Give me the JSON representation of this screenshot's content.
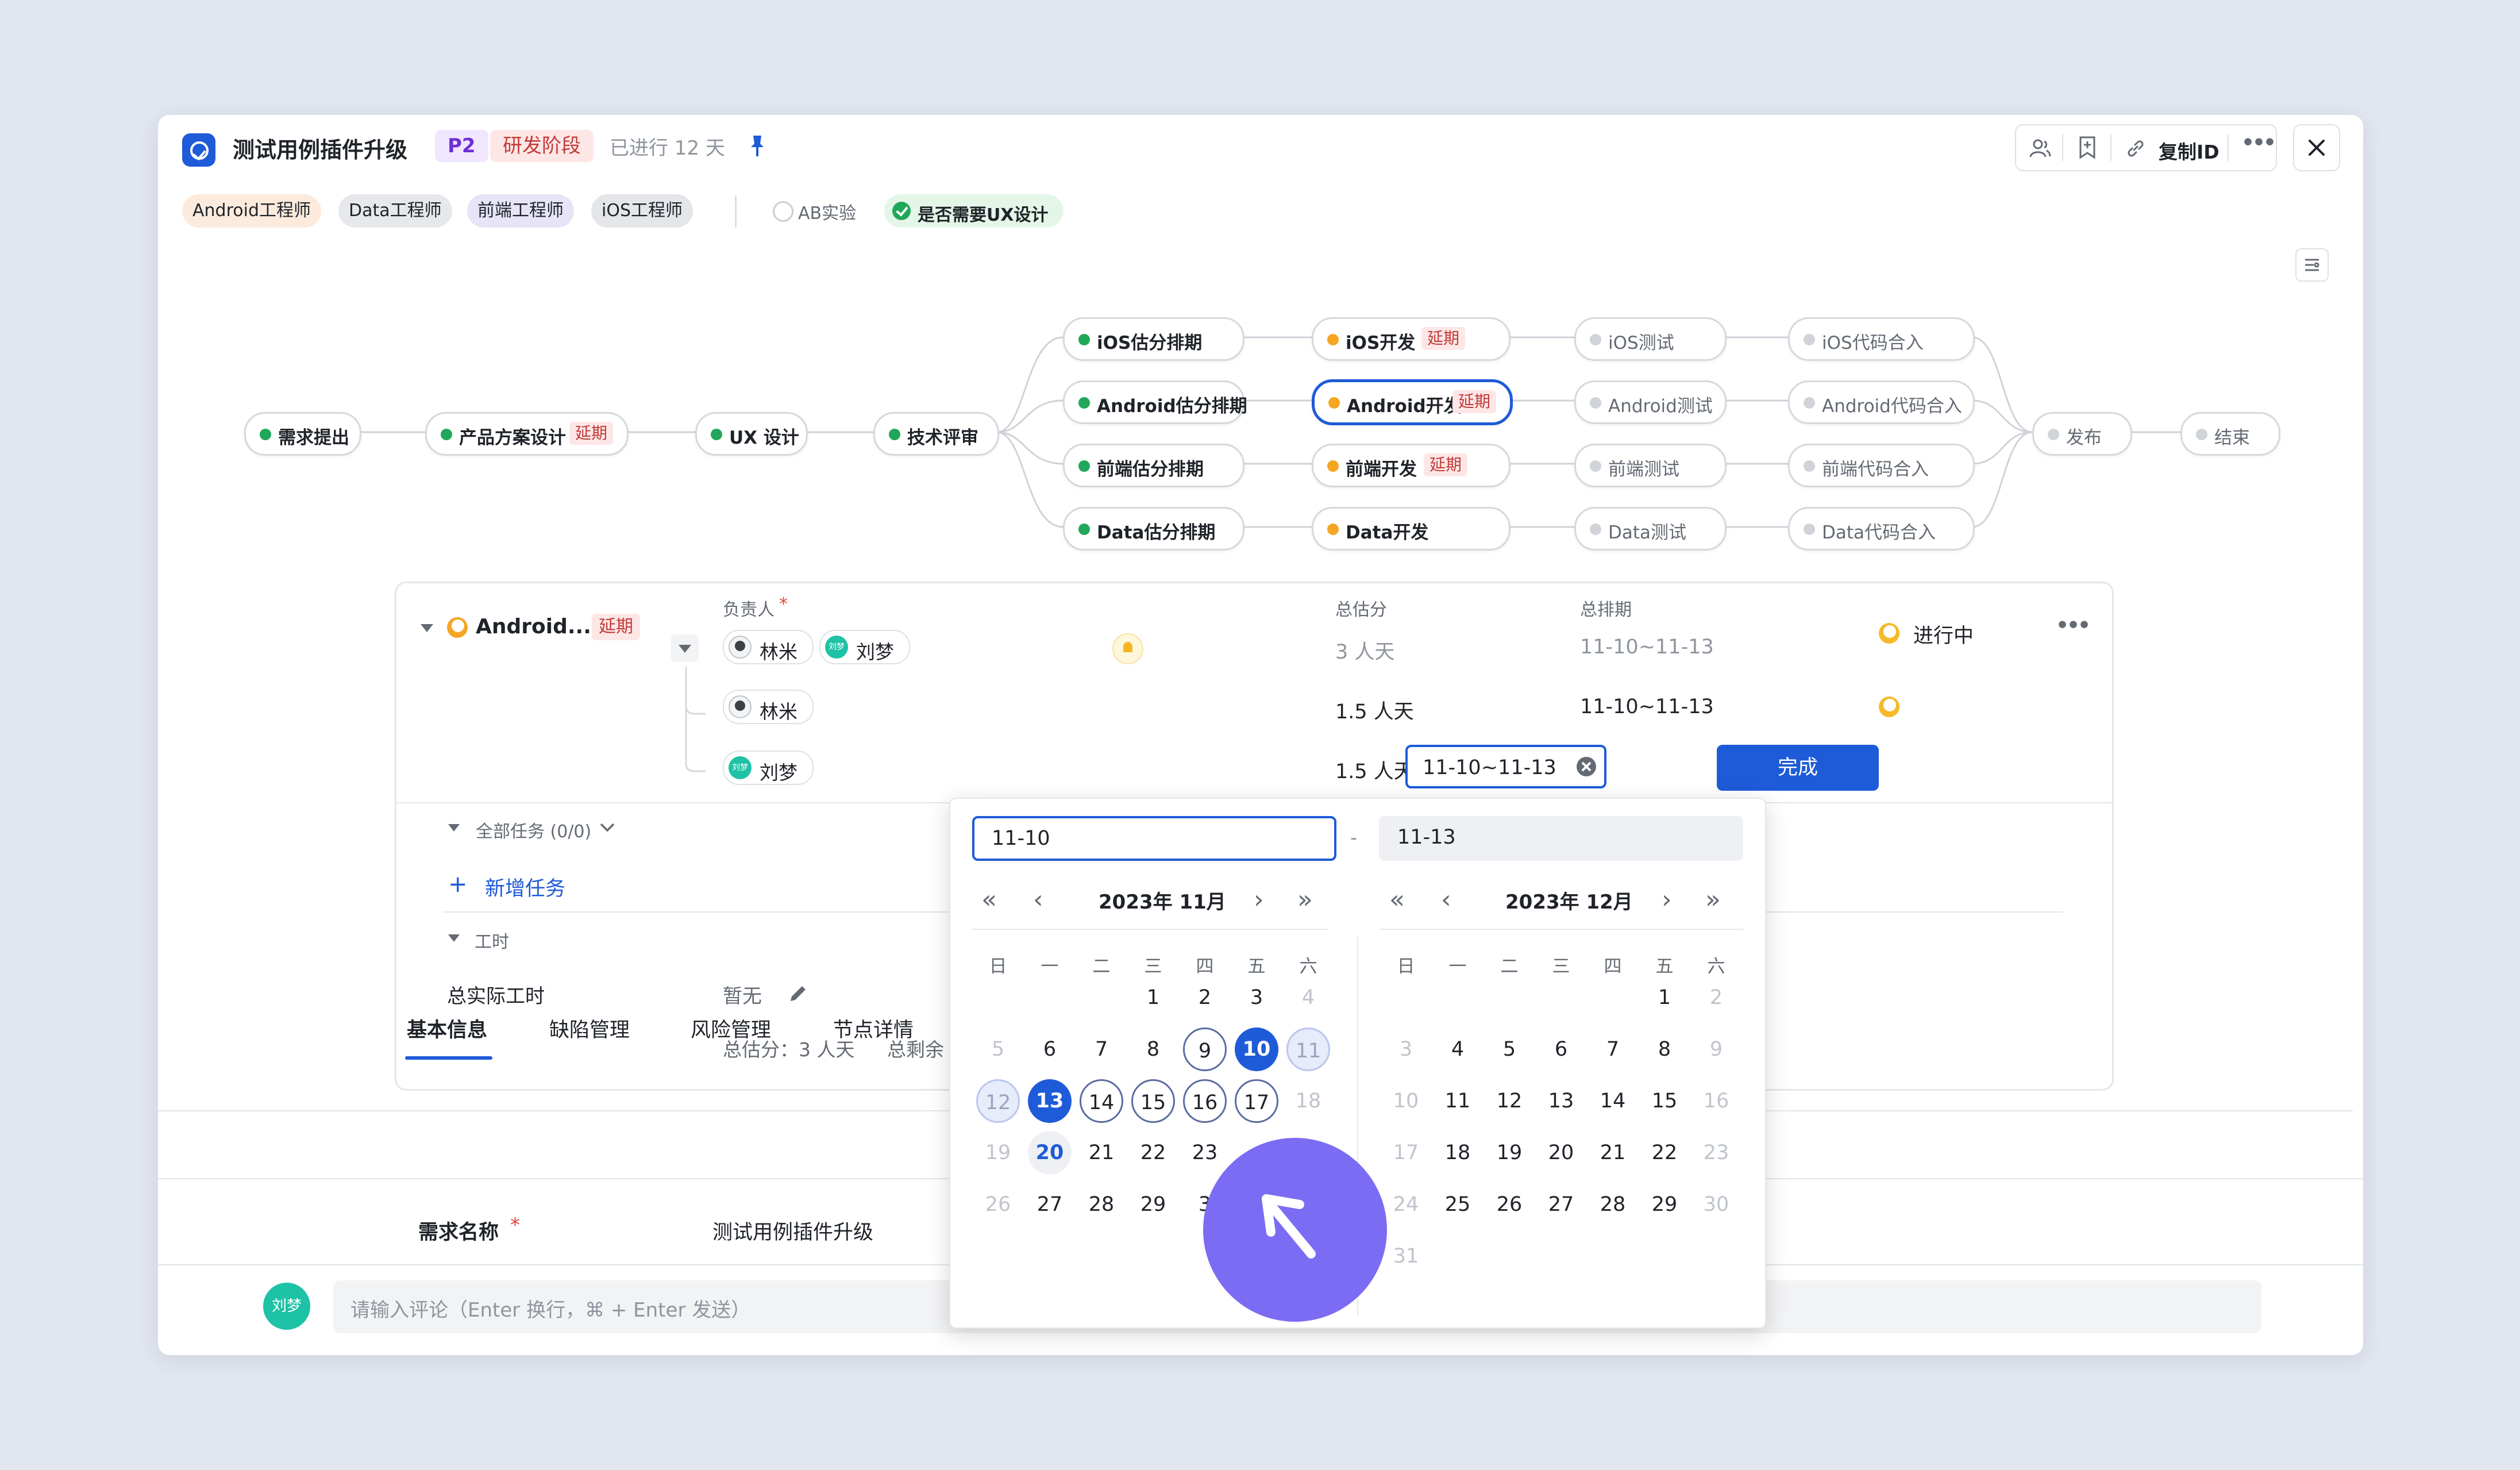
{
  "header": {
    "title": "测试用例插件升级",
    "priority": "P2",
    "stage": "研发阶段",
    "elapsed": "已进行 12 天",
    "copy_id_label": "复制ID"
  },
  "tags": [
    "Android工程师",
    "Data工程师",
    "前端工程师",
    "iOS工程师"
  ],
  "ab_label": "AB实验",
  "ux_label": "是否需要UX设计",
  "flow": {
    "delay_label": "延期",
    "nodes": {
      "n1": "需求提出",
      "n2": "产品方案设计",
      "n3": "UX 设计",
      "n4": "技术评审",
      "ios_est": "iOS估分排期",
      "and_est": "Android估分排期",
      "fe_est": "前端估分排期",
      "data_est": "Data估分排期",
      "ios_dev": "iOS开发",
      "and_dev": "Android开发",
      "fe_dev": "前端开发",
      "data_dev": "Data开发",
      "ios_test": "iOS测试",
      "and_test": "Android测试",
      "fe_test": "前端测试",
      "data_test": "Data测试",
      "ios_merge": "iOS代码合入",
      "and_merge": "Android代码合入",
      "fe_merge": "前端代码合入",
      "data_merge": "Data代码合入",
      "release": "发布",
      "end": "结束"
    }
  },
  "detail": {
    "node_name": "Android...",
    "delay": "延期",
    "owner_label": "负责人",
    "required_mark": "*",
    "estimate_label": "总估分",
    "schedule_label": "总排期",
    "users": {
      "u1": "林米",
      "u2": "刘梦"
    },
    "avatar_text": "刘梦",
    "rows": [
      {
        "estimate": "3 人天",
        "schedule": "11-10~11-13",
        "status": "进行中"
      },
      {
        "estimate": "1.5 人天",
        "schedule": "11-10~11-13"
      },
      {
        "estimate": "1.5 人天",
        "schedule": "11-10~11-13"
      }
    ],
    "done_button": "完成",
    "all_tasks": "全部任务 (0/0)",
    "add_task": "新增任务",
    "worktime": "工时",
    "actual_label": "总实际工时",
    "actual_value": "暂无",
    "summary_est": "总估分：3 人天",
    "summary_remain": "总剩余"
  },
  "tabs": [
    "基本信息",
    "缺陷管理",
    "风险管理",
    "节点详情"
  ],
  "basic": {
    "name_label": "需求名称",
    "name_value": "测试用例插件升级"
  },
  "comment": {
    "avatar_text": "刘梦",
    "placeholder": "请输入评论（Enter 换行，⌘ + Enter 发送）"
  },
  "picker": {
    "start_value": "11-10",
    "end_value": "11-13",
    "separator": "-",
    "left_title": "2023年 11月",
    "right_title": "2023年 12月",
    "weekdays": [
      "日",
      "一",
      "二",
      "三",
      "四",
      "五",
      "六"
    ],
    "nav": {
      "prev_year": "«",
      "prev_month": "‹",
      "next_month": "›",
      "next_year": "»"
    },
    "nov_days": [
      [
        "",
        "",
        "",
        "1",
        "2",
        "3",
        "4"
      ],
      [
        "5",
        "6",
        "7",
        "8",
        "9",
        "10",
        "11"
      ],
      [
        "12",
        "13",
        "14",
        "15",
        "16",
        "17",
        "18"
      ],
      [
        "19",
        "20",
        "21",
        "22",
        "23",
        "",
        ""
      ],
      [
        "26",
        "27",
        "28",
        "29",
        "3",
        "",
        ""
      ]
    ],
    "dec_days": [
      [
        "",
        "",
        "",
        "",
        "",
        "1",
        "2"
      ],
      [
        "3",
        "4",
        "5",
        "6",
        "7",
        "8",
        "9"
      ],
      [
        "10",
        "11",
        "12",
        "13",
        "14",
        "15",
        "16"
      ],
      [
        "17",
        "18",
        "19",
        "20",
        "21",
        "22",
        "23"
      ],
      [
        "24",
        "25",
        "26",
        "27",
        "28",
        "29",
        "30"
      ],
      [
        "31",
        "",
        "",
        "",
        "",
        "",
        ""
      ]
    ]
  },
  "colors": {
    "accent": "#1E5BD8",
    "success": "#21A75A",
    "warning": "#F5A623",
    "danger": "#C23A38"
  }
}
